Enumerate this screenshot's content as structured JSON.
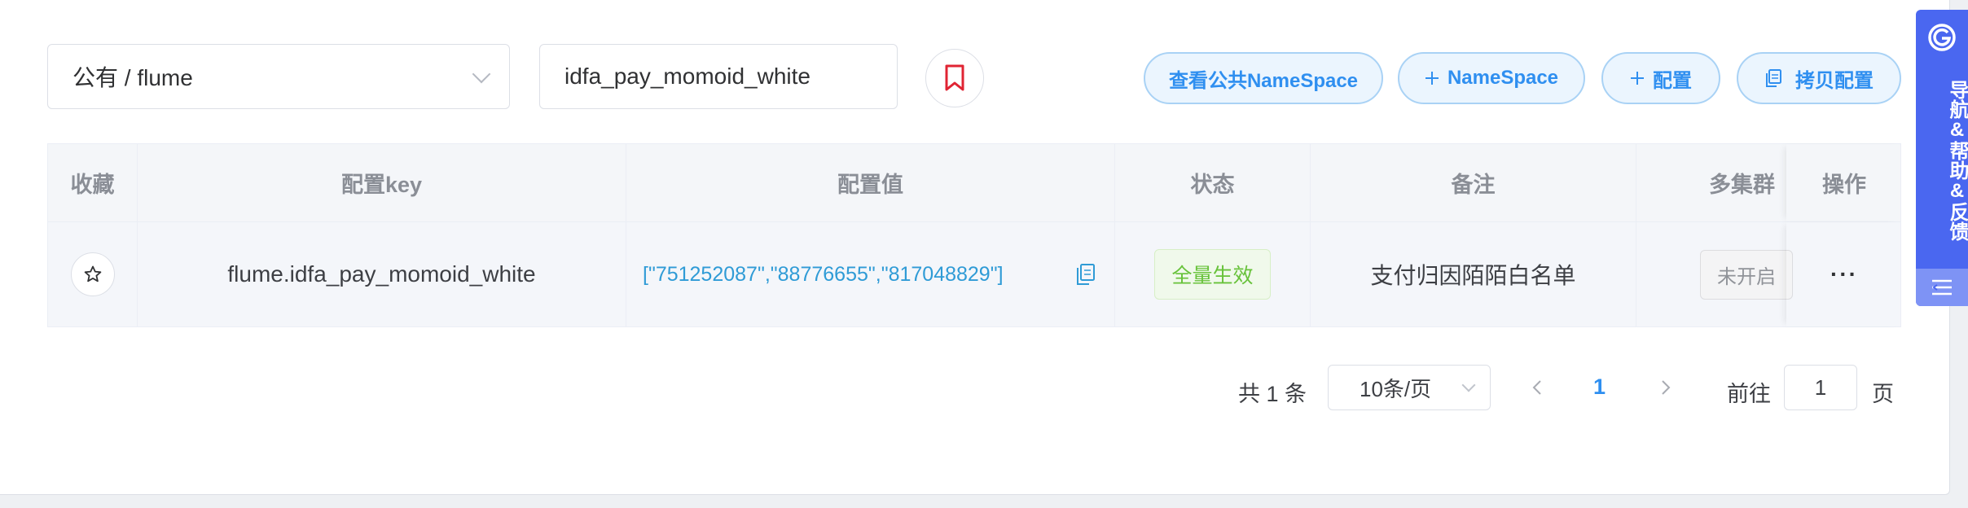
{
  "toolbar": {
    "namespace_select_value": "公有 / flume",
    "key_input_value": "idfa_pay_momoid_white",
    "view_public_namespace_label": "查看公共NameSpace",
    "add_namespace_label": "NameSpace",
    "add_config_label": "配置",
    "copy_config_label": "拷贝配置"
  },
  "table": {
    "headers": [
      "收藏",
      "配置key",
      "配置值",
      "状态",
      "备注",
      "多集群",
      "操作"
    ],
    "rows": [
      {
        "key": "flume.idfa_pay_momoid_white",
        "value": "[\"751252087\",\"88776655\",\"817048829\"]",
        "status": "全量生效",
        "remark": "支付归因陌陌白名单",
        "multi_cluster": "未开启",
        "actions": "···"
      }
    ]
  },
  "pagination": {
    "total_text": "共 1 条",
    "page_size": "10条/页",
    "current_page": "1",
    "goto_label": "前往",
    "goto_value": "1",
    "page_suffix": "页"
  },
  "helpbar": {
    "label": "导航&帮助&反馈"
  },
  "colors": {
    "accent": "#2f8ff0",
    "bookmark_red": "#e02433",
    "status_green": "#67c23a",
    "helpbar_blue": "#4a67f0"
  }
}
